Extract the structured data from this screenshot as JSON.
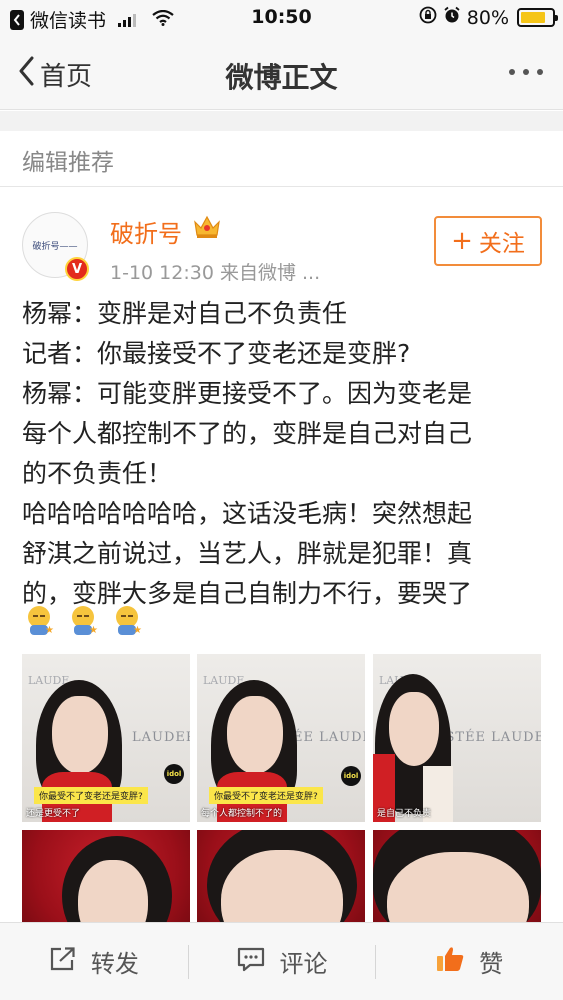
{
  "status_bar": {
    "back_app": "微信读书",
    "time": "10:50",
    "battery": "80%",
    "battery_level": 0.8
  },
  "nav": {
    "back_label": "首页",
    "title": "微博正文"
  },
  "section": {
    "title": "编辑推荐"
  },
  "post": {
    "author": "破折号",
    "avatar_text": "破折号——",
    "meta": "1-10 12:30   来自微博 ...",
    "follow_label": "关注",
    "lines": [
      "杨幂：变胖是对自己不负责任",
      "记者：你最接受不了变老还是变胖?",
      "杨幂：可能变胖更接受不了。因为变老是",
      "每个人都控制不了的，变胖是自己对自己",
      "的不负责任！",
      "哈哈哈哈哈哈哈，这话没毛病！突然想起",
      "舒淇之前说过，当艺人，胖就是犯罪！真",
      "的，变胖大多是自己自制力不行，要哭了"
    ],
    "emoji_icons": [
      "sad-face-icon",
      "sad-face-icon",
      "sad-face-icon"
    ],
    "photos": {
      "brand_1": "LAUDER",
      "brand_2": "ÉE LAUDER",
      "brand_3": "ESTÉE LAUDER",
      "brand_top": "LAUDE",
      "subtitle_1": "你最受不了变老还是变胖?",
      "subtitle_2": "你最受不了变老还是变胖?",
      "caption_1": "还是更受不了",
      "caption_2": "每个人都控制不了的",
      "caption_3": "是自己不负责",
      "idol_logo": "idol"
    }
  },
  "toolbar": {
    "repost_label": "转发",
    "comment_label": "评论",
    "like_label": "赞"
  },
  "colors": {
    "accent": "#f26e1b",
    "text": "#222222",
    "meta": "#999999"
  }
}
